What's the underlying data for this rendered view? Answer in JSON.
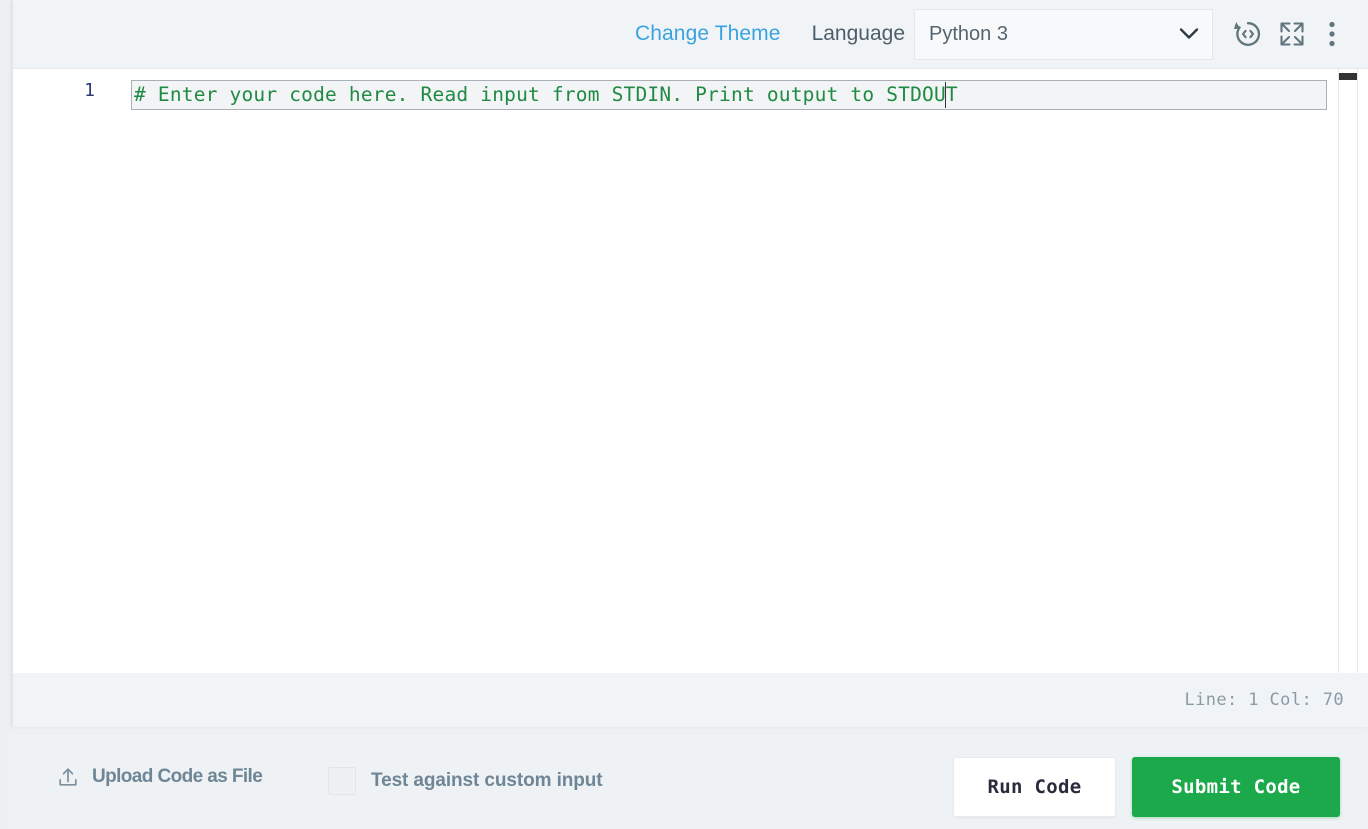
{
  "editor": {
    "header": {
      "change_theme_label": "Change Theme",
      "language_label": "Language",
      "selected_language": "Python 3",
      "language_options": [
        "Python 3"
      ],
      "icons": {
        "restore": "restore-code-icon",
        "expand": "fullscreen-expand-icon",
        "kebab": "more-options-icon"
      }
    },
    "code": {
      "line_number": "1",
      "line_text": "# Enter your code here. Read input from STDIN. Print output to STDOUT"
    },
    "status": {
      "position": "Line: 1 Col: 70"
    }
  },
  "bottom_bar": {
    "upload_label": "Upload Code as File",
    "upload_icon": "upload-icon",
    "custom_input_label": "Test against custom input",
    "custom_input_checked": false,
    "run_label": "Run Code",
    "submit_label": "Submit Code"
  },
  "colors": {
    "accent_link": "#39a3e0",
    "submit_green": "#1ba94c",
    "comment_green": "#1f8a43",
    "panel_header": "#f1f4f6",
    "page_background": "#eef1f3"
  }
}
